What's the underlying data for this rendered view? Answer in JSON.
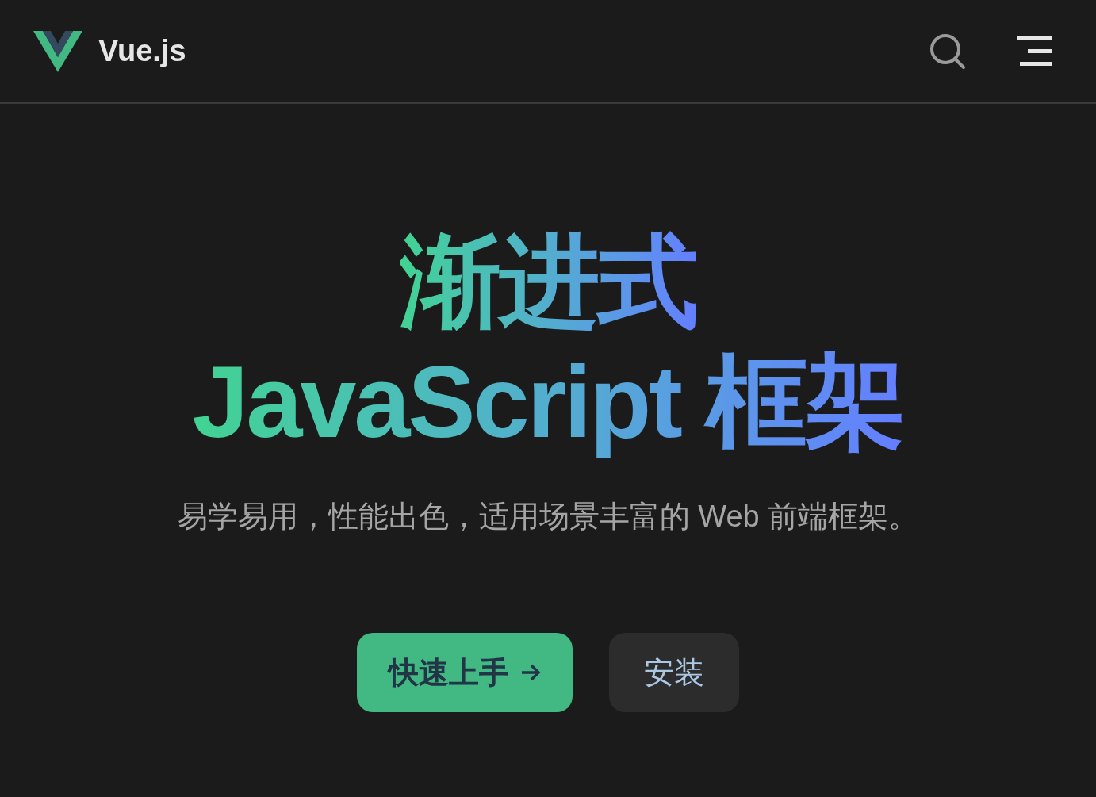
{
  "header": {
    "logo_text": "Vue.js"
  },
  "hero": {
    "title_lines": [
      "渐进式",
      "JavaScript 框架"
    ],
    "tagline": "易学易用，性能出色，适用场景丰富的 Web 前端框架。"
  },
  "buttons": [
    {
      "label": "快速上手",
      "kind": "primary"
    },
    {
      "label": "安装",
      "kind": "secondary"
    }
  ]
}
